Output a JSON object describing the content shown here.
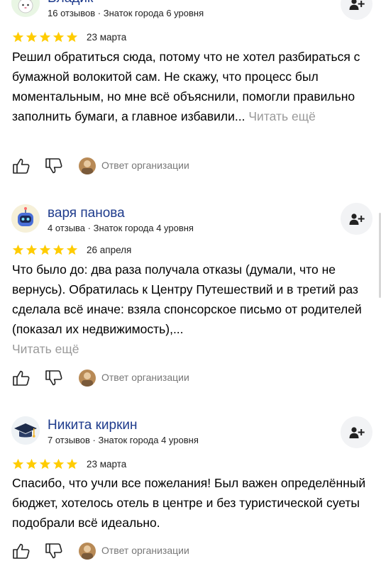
{
  "reviews": [
    {
      "author": "Владик",
      "meta": "16 отзывов · Знаток города 6 уровня",
      "rating": 5,
      "date": "23 марта",
      "text": "Решил обратиться сюда, потому что не хотел разбираться с бумажной волокитой сам. Не скажу, что процесс был моментальным, но мне всё объяснили, помогли правильно заполнить бумаги, а главное избавили...",
      "read_more": "Читать ещё",
      "org_reply": "Ответ организации",
      "avatar_icon": "bunny-avatar-icon"
    },
    {
      "author": "варя панова",
      "meta": "4 отзыва · Знаток города 4 уровня",
      "rating": 5,
      "date": "26 апреля",
      "text": "Что было до: два раза получала отказы (думали, что не вернусь). Обратилась к Центру Путешествий и в третий раз сделала всё иначе: взяла спонсорское письмо от родителей (показал их недвижимость),...",
      "read_more": "Читать ещё",
      "org_reply": "Ответ организации",
      "avatar_icon": "robot-avatar-icon"
    },
    {
      "author": "Никита киркин",
      "meta": "7 отзывов · Знаток города 4 уровня",
      "rating": 5,
      "date": "23 марта",
      "text": "Спасибо, что учли все пожелания! Был важен определённый бюджет, хотелось отель в центре и без туристической суеты подобрали всё идеально.",
      "read_more": "",
      "org_reply": "Ответ организации",
      "avatar_icon": "graduation-cap-avatar-icon"
    }
  ],
  "colors": {
    "author": "#1e3b8c",
    "star": "#fc0",
    "muted": "#9a9a9a",
    "button_bg": "#f2f3f5"
  }
}
